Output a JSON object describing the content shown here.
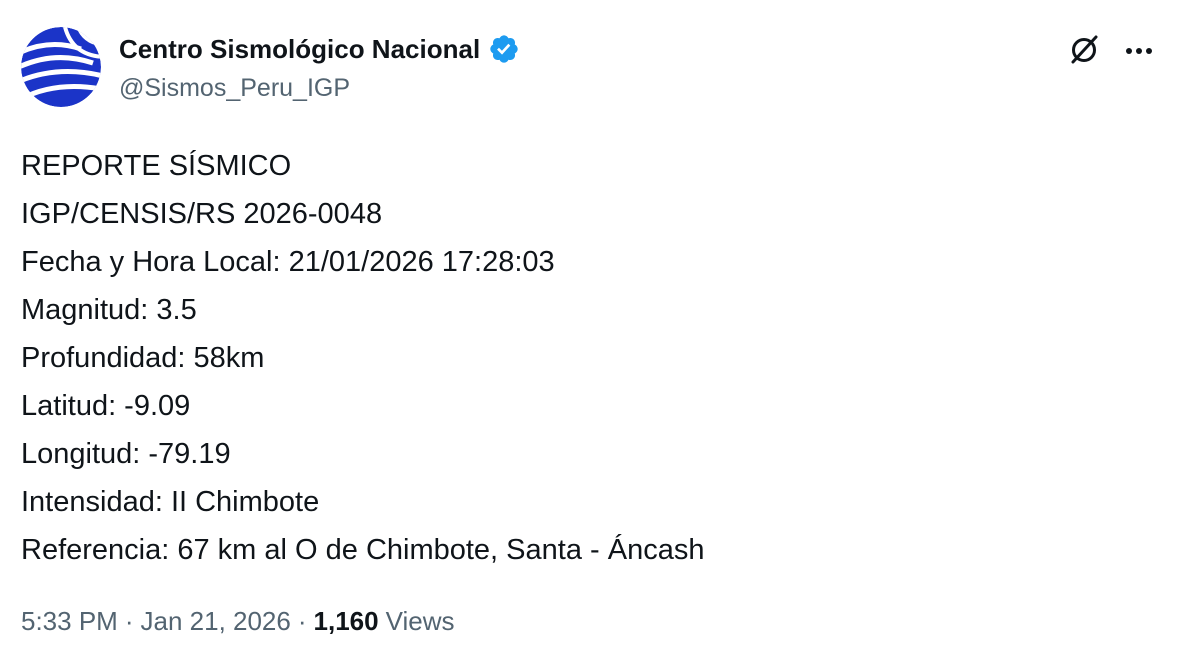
{
  "author": {
    "display_name": "Centro Sismológico Nacional",
    "handle": "@Sismos_Peru_IGP",
    "verified": true,
    "avatar_icon": "igp-logo-icon"
  },
  "toolbar": {
    "grok_icon": "grok-icon",
    "more_icon": "more-options-icon"
  },
  "post": {
    "lines": [
      "REPORTE SÍSMICO",
      "IGP/CENSIS/RS 2026-0048",
      "Fecha y Hora Local: 21/01/2026 17:28:03",
      "Magnitud: 3.5",
      "Profundidad: 58km",
      "Latitud: -9.09",
      "Longitud: -79.19",
      "Intensidad: II Chimbote",
      "Referencia: 67 km al O de Chimbote, Santa - Áncash"
    ]
  },
  "meta": {
    "time": "5:33 PM",
    "separator": "·",
    "date": "Jan 21, 2026",
    "views_count": "1,160",
    "views_label": "Views"
  },
  "colors": {
    "text": "#0f1419",
    "secondary": "#536471",
    "verified": "#1d9bf0",
    "avatar_blue": "#1b34c8"
  }
}
